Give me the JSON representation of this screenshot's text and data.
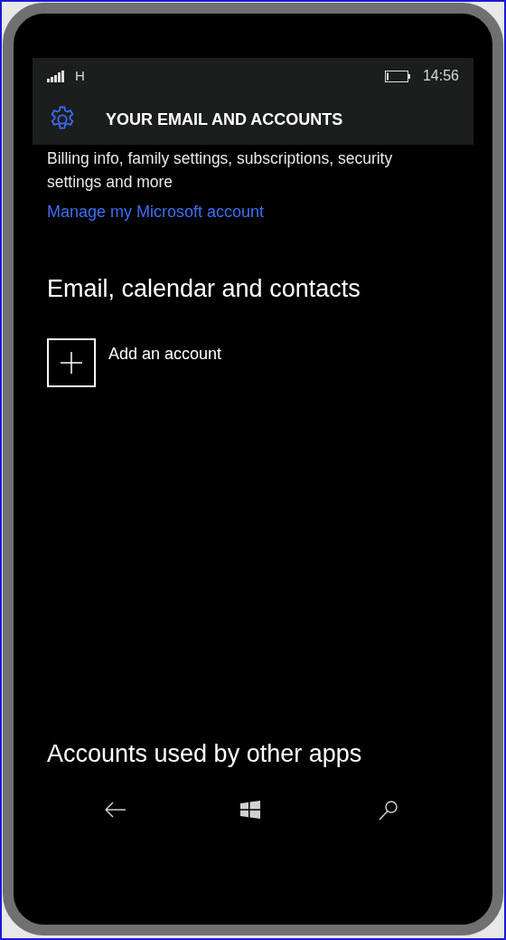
{
  "status_bar": {
    "network": "H",
    "time": "14:56"
  },
  "header": {
    "title": "YOUR EMAIL AND ACCOUNTS"
  },
  "description": "Billing info, family settings, subscriptions, security settings and more",
  "link": "Manage my Microsoft account",
  "sections": [
    {
      "heading": "Email, calendar and contacts",
      "items": [
        {
          "label": "Add an account"
        }
      ]
    },
    {
      "heading": "Accounts used by other apps"
    }
  ],
  "nav_buttons": [
    {
      "kind": "back"
    },
    {
      "kind": "start"
    },
    {
      "kind": "search"
    }
  ]
}
